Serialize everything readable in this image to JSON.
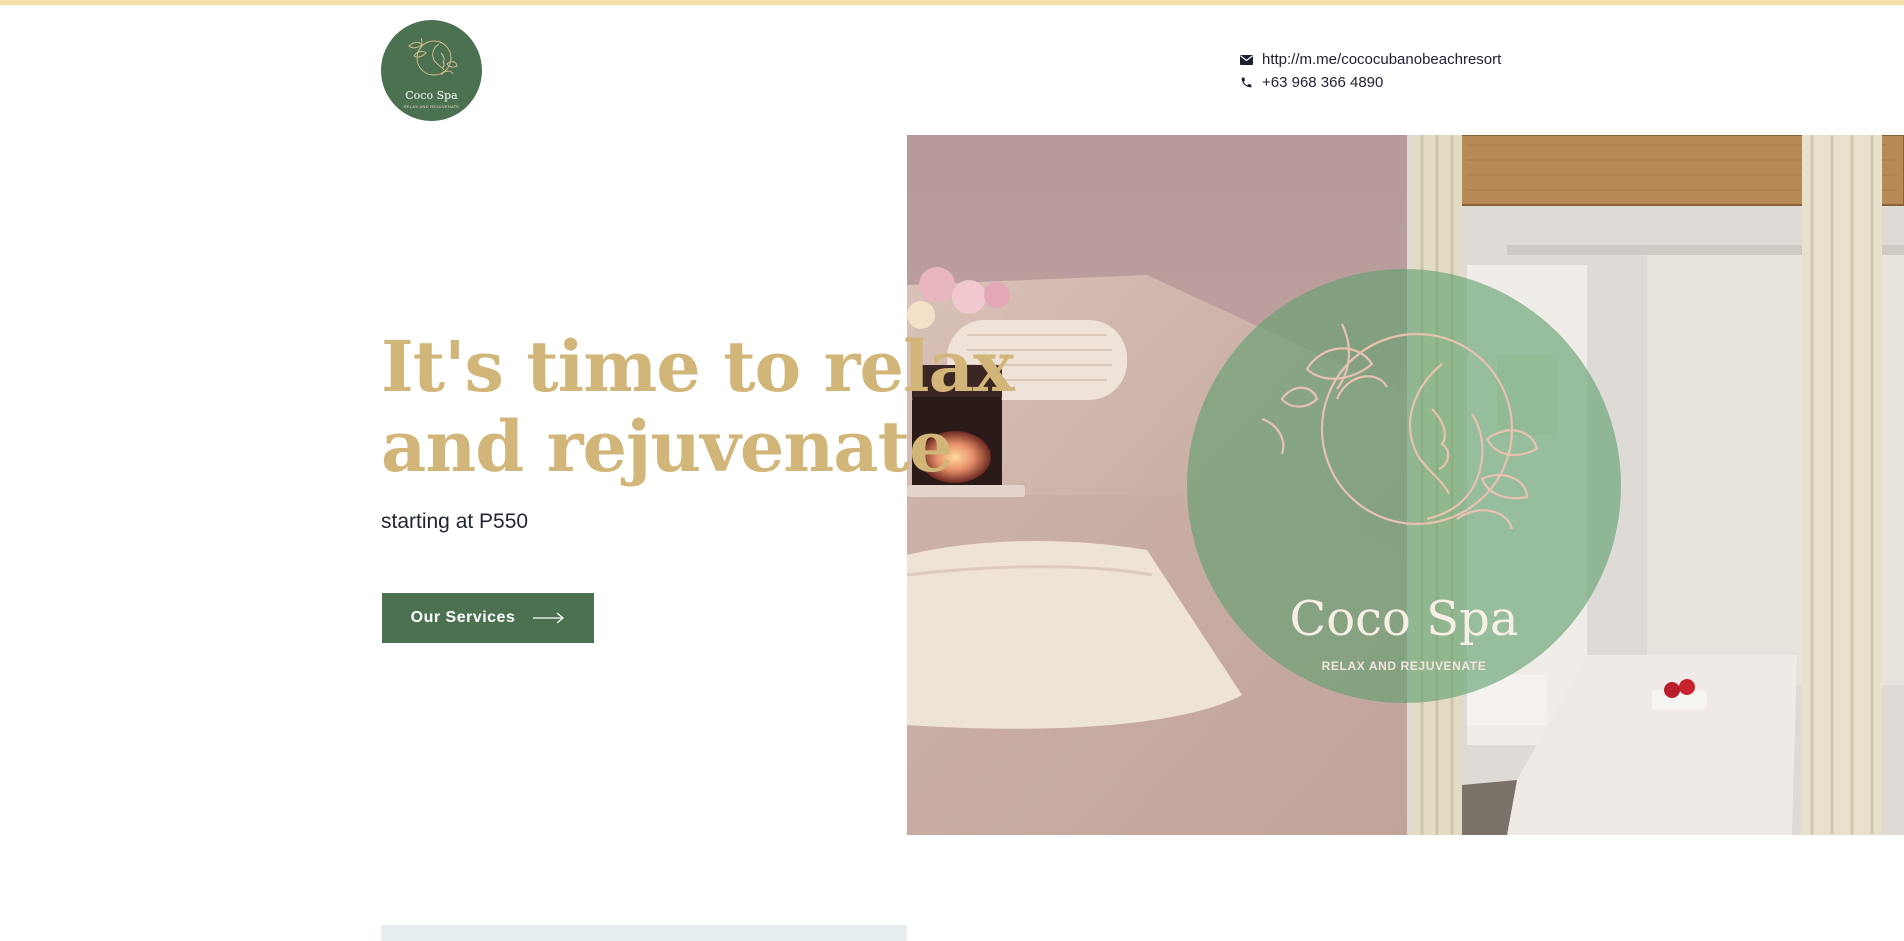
{
  "header": {
    "logo": {
      "name": "Coco Spa",
      "tagline": "RELAX AND REJUVENATE",
      "icon": "woman-flower-logo-icon"
    },
    "contact": {
      "messenger": {
        "icon": "envelope-icon",
        "text": "http://m.me/cococubanobeachresort"
      },
      "phone": {
        "icon": "phone-icon",
        "text": "+63 968 366 4890"
      }
    }
  },
  "hero": {
    "title_line1": "It's time to relax",
    "title_line2": "and rejuvenate",
    "subtitle": "starting at P550",
    "cta_label": "Our Services",
    "cta_icon": "arrow-right-icon",
    "image": {
      "badge_name": "Coco Spa",
      "badge_tagline": "RELAX AND REJUVENATE"
    }
  },
  "colors": {
    "brand_green": "#4b7150",
    "gold": "#d2b679",
    "top_accent": "#f6dca8",
    "text_dark": "#1f2632"
  }
}
